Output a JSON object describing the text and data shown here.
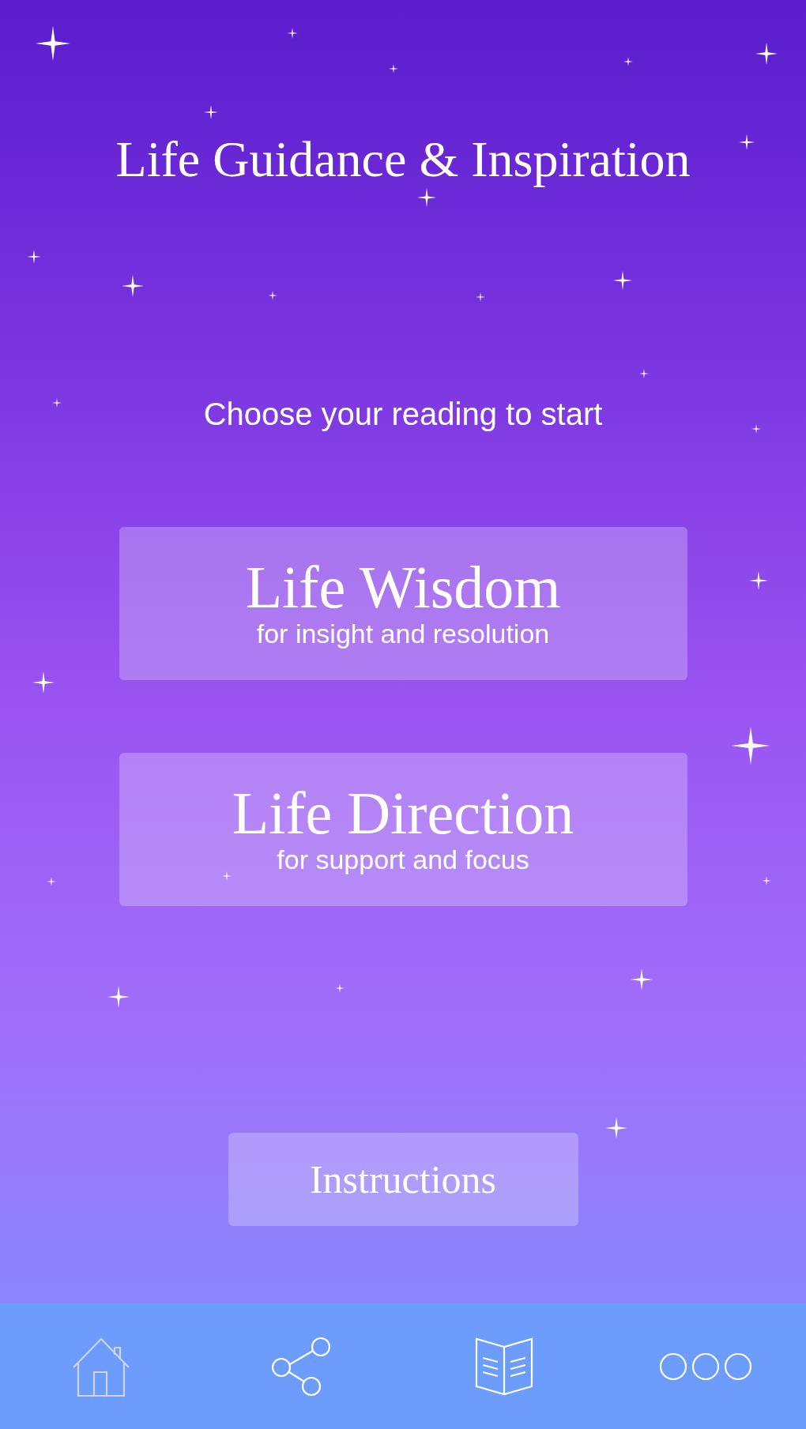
{
  "title": "Life Guidance & Inspiration",
  "prompt": "Choose your reading to start",
  "readings": [
    {
      "title": "Life Wisdom",
      "subtitle": "for insight and resolution"
    },
    {
      "title": "Life Direction",
      "subtitle": "for support and focus"
    }
  ],
  "instructions_button": "Instructions",
  "tab_bar": [
    {
      "kind": "home",
      "selected": true
    },
    {
      "kind": "share",
      "selected": false
    },
    {
      "kind": "book",
      "selected": false
    },
    {
      "kind": "more",
      "selected": false
    }
  ]
}
